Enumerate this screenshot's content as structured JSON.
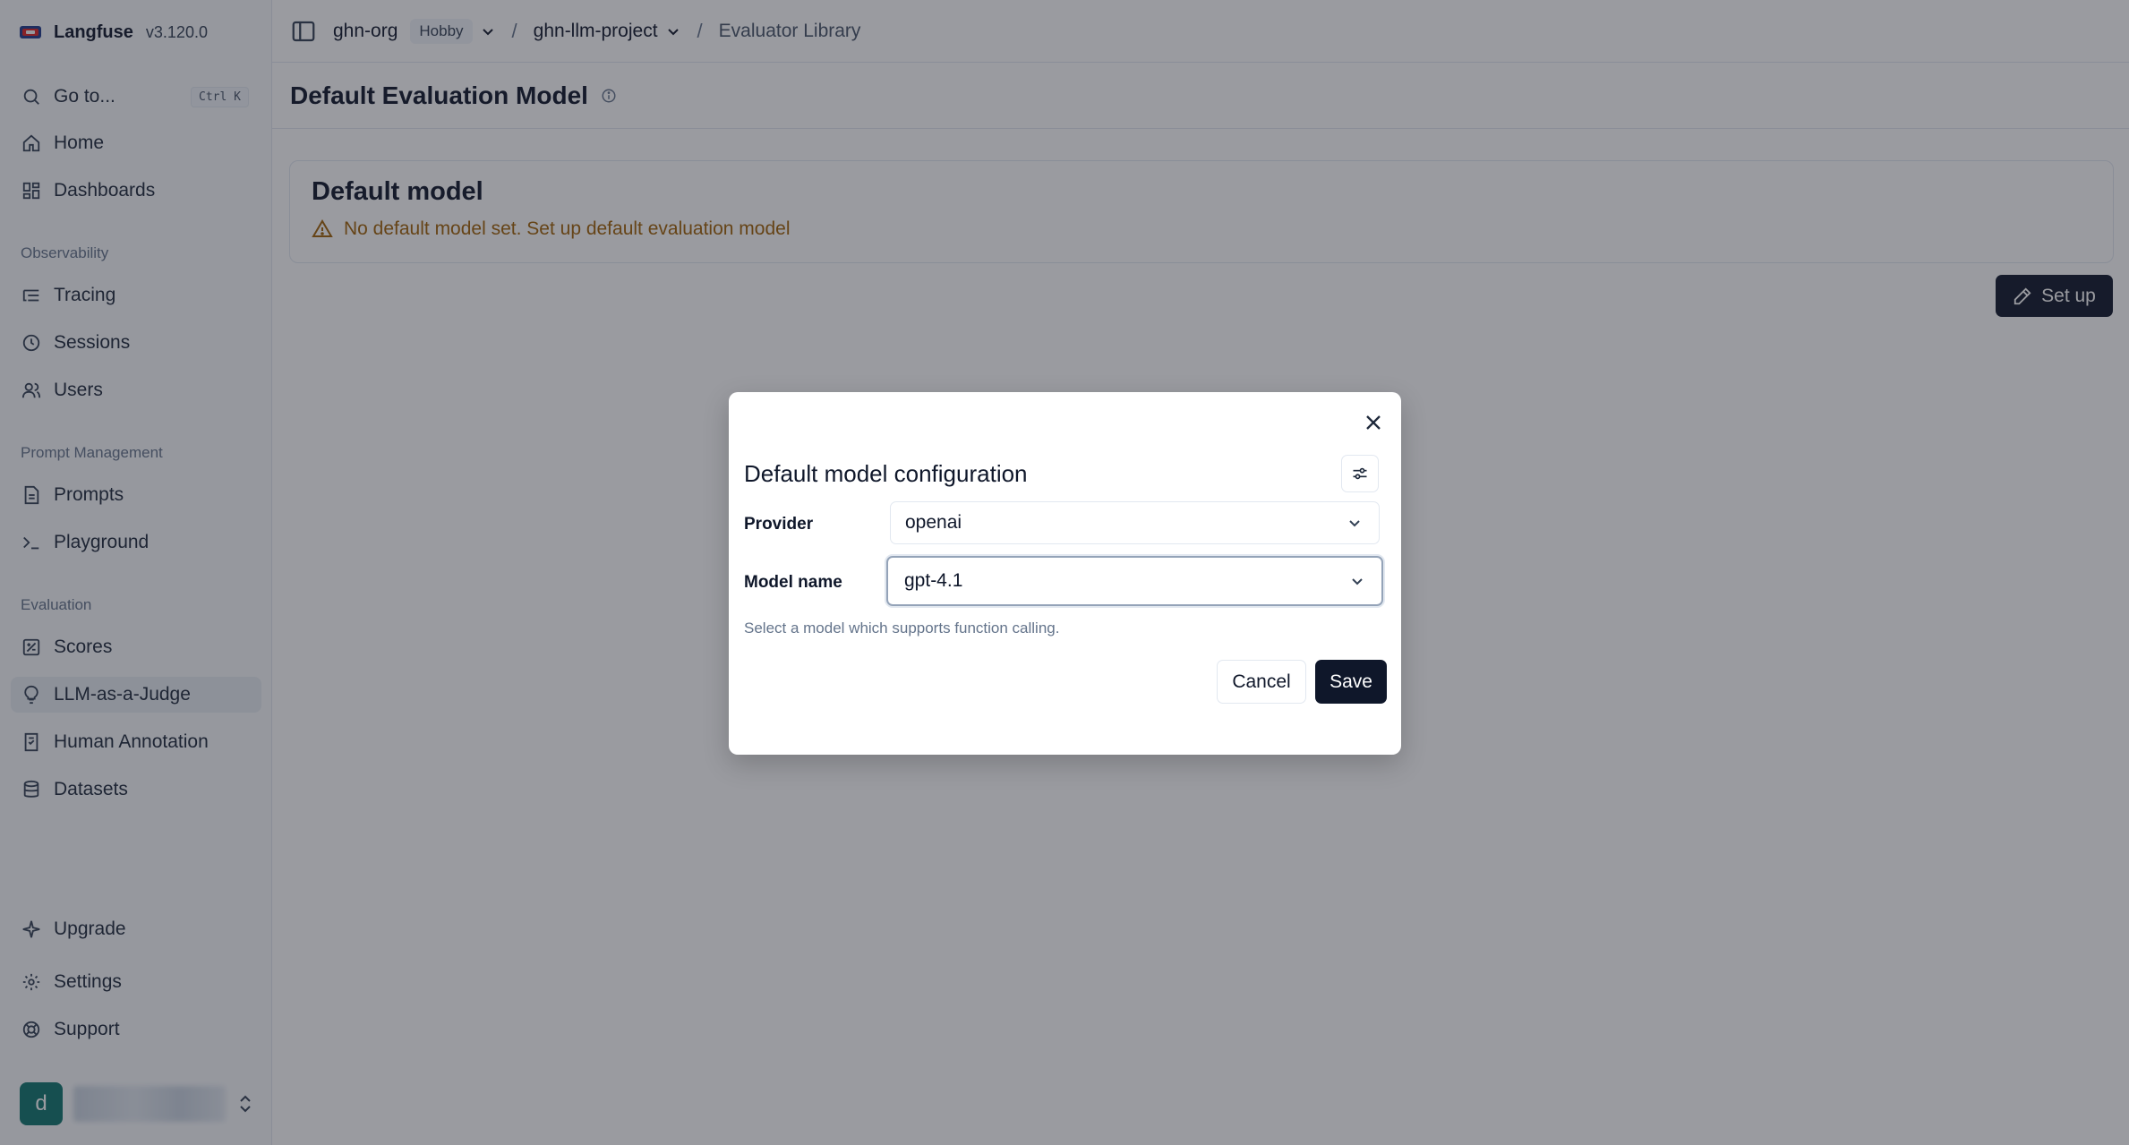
{
  "app": {
    "name": "Langfuse",
    "version": "v3.120.0"
  },
  "sidebar": {
    "goto": {
      "label": "Go to...",
      "shortcut": "Ctrl K"
    },
    "top_items": [
      {
        "label": "Home",
        "icon": "home-icon"
      },
      {
        "label": "Dashboards",
        "icon": "dashboard-grid-icon"
      }
    ],
    "sections": [
      {
        "label": "Observability",
        "items": [
          {
            "label": "Tracing",
            "icon": "list-tree-icon"
          },
          {
            "label": "Sessions",
            "icon": "clock-icon"
          },
          {
            "label": "Users",
            "icon": "users-icon"
          }
        ]
      },
      {
        "label": "Prompt Management",
        "items": [
          {
            "label": "Prompts",
            "icon": "file-text-icon"
          },
          {
            "label": "Playground",
            "icon": "terminal-icon"
          }
        ]
      },
      {
        "label": "Evaluation",
        "items": [
          {
            "label": "Scores",
            "icon": "score-square-icon"
          },
          {
            "label": "LLM-as-a-Judge",
            "icon": "lightbulb-icon",
            "active": true
          },
          {
            "label": "Human Annotation",
            "icon": "annotation-icon"
          },
          {
            "label": "Datasets",
            "icon": "database-icon"
          }
        ]
      }
    ],
    "bottom_items": [
      {
        "label": "Upgrade",
        "icon": "sparkle-icon"
      },
      {
        "label": "Settings",
        "icon": "gear-icon"
      },
      {
        "label": "Support",
        "icon": "lifebuoy-icon"
      }
    ],
    "user": {
      "initial": "d"
    }
  },
  "topbar": {
    "org": "ghn-org",
    "plan": "Hobby",
    "project": "ghn-llm-project",
    "page": "Evaluator Library",
    "separator": "/"
  },
  "page": {
    "title": "Default Evaluation Model",
    "card_title": "Default model",
    "warning": "No default model set. Set up default evaluation model",
    "setup_button": "Set up"
  },
  "modal": {
    "title": "Default model configuration",
    "provider_label": "Provider",
    "provider_value": "openai",
    "model_label": "Model name",
    "model_value": "gpt-4.1",
    "helper": "Select a model which supports function calling.",
    "cancel": "Cancel",
    "save": "Save"
  },
  "colors": {
    "primary": "#0f172a",
    "warning": "#a16207",
    "active_bg": "#e8edf3",
    "avatar": "#0f766e"
  }
}
